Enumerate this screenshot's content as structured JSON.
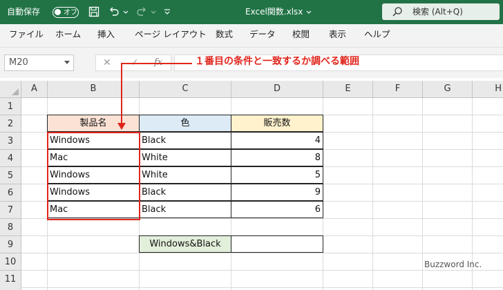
{
  "titlebar": {
    "autosave_label": "自動保存",
    "autosave_state": "オフ",
    "doc_title": "Excel関数.xlsx",
    "search_text": "検索 (Alt+Q)",
    "icons": [
      "save-icon",
      "undo-icon",
      "redo-icon",
      "customize-icon"
    ]
  },
  "ribbon": {
    "tabs": [
      "ファイル",
      "ホーム",
      "挿入",
      "ページ レイアウト",
      "数式",
      "データ",
      "校閲",
      "表示",
      "ヘルプ"
    ]
  },
  "formula_bar": {
    "name_box": "M20",
    "cancel_symbol": "✕",
    "enter_symbol": "✓",
    "fx_label": "fx",
    "formula": ""
  },
  "annotation": {
    "text": "１番目の条件と一致するか調べる範囲",
    "color": "#e0251b"
  },
  "grid": {
    "columns": [
      "A",
      "B",
      "C",
      "D",
      "E",
      "F",
      "G",
      "H"
    ],
    "rows": [
      "1",
      "2",
      "3",
      "4",
      "5",
      "6",
      "7",
      "8",
      "9",
      "10",
      "11"
    ],
    "header": {
      "product": "製品名",
      "color": "色",
      "sales": "販売数"
    },
    "header_colors": {
      "product": "#fbe2d5",
      "color": "#ddebf7",
      "sales": "#fff2cc"
    },
    "data_rows": [
      {
        "product": "Windows",
        "color": "Black",
        "sales": "4"
      },
      {
        "product": "Mac",
        "color": "White",
        "sales": "8"
      },
      {
        "product": "Windows",
        "color": "White",
        "sales": "5"
      },
      {
        "product": "Windows",
        "color": "Black",
        "sales": "9"
      },
      {
        "product": "Mac",
        "color": "Black",
        "sales": "6"
      }
    ],
    "criteria_cell": "Windows&Black",
    "criteria_color": "#e2efda",
    "result_cell": ""
  },
  "watermark": "Buzzword Inc.",
  "colors": {
    "title_bar": "#217346",
    "accent_red": "#e0251b"
  }
}
